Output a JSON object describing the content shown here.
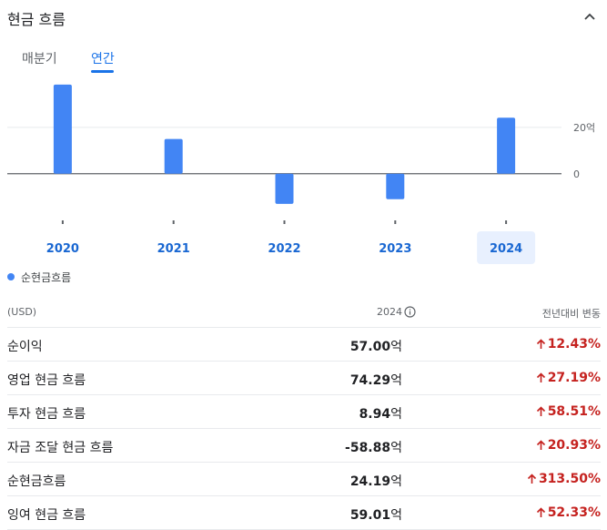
{
  "header": {
    "title": "현금 흐름"
  },
  "tabs": [
    {
      "label": "매분기",
      "active": false
    },
    {
      "label": "연간",
      "active": true
    }
  ],
  "chart_data": {
    "type": "bar",
    "categories": [
      "2020",
      "2021",
      "2022",
      "2023",
      "2024"
    ],
    "series": [
      {
        "name": "순현금흐름",
        "values": [
          38.5,
          15.0,
          -13.0,
          -11.0,
          24.19
        ]
      }
    ],
    "selected_category": "2024",
    "y_ticks": [
      {
        "value": 20,
        "label": "20억"
      },
      {
        "value": 0,
        "label": "0"
      }
    ],
    "ylim": [
      -17,
      42
    ],
    "colors": {
      "bar": "#4285f4",
      "selected_bg": "#e8f0fe",
      "category_label": "#1967d2"
    }
  },
  "legend": {
    "label": "순현금흐름"
  },
  "table": {
    "headers": {
      "label": "(USD)",
      "year": "2024",
      "change": "전년대비 변동"
    },
    "unit": "억",
    "rows": [
      {
        "label": "순이익",
        "value": "57.00",
        "change": "12.43%"
      },
      {
        "label": "영업 현금 흐름",
        "value": "74.29",
        "change": "27.19%"
      },
      {
        "label": "투자 현금 흐름",
        "value": "8.94",
        "change": "58.51%"
      },
      {
        "label": "자금 조달 현금 흐름",
        "value": "-58.88",
        "change": "20.93%"
      },
      {
        "label": "순현금흐름",
        "value": "24.19",
        "change": "313.50%"
      },
      {
        "label": "잉여 현금 흐름",
        "value": "59.01",
        "change": "52.33%"
      }
    ]
  }
}
